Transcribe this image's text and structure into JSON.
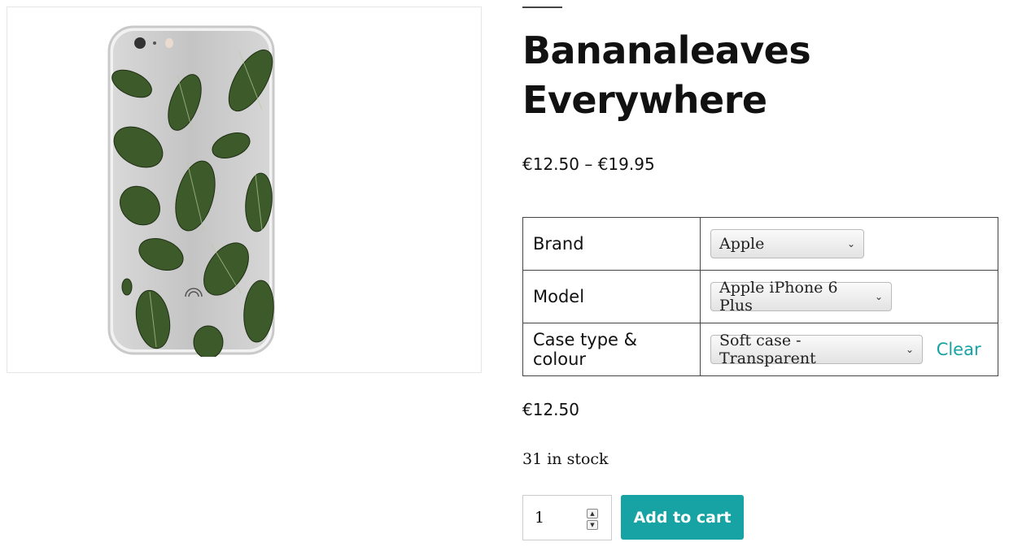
{
  "product": {
    "title": "Bananaleaves Everywhere",
    "price_range": "€12.50 – €19.95",
    "selected_price": "€12.50",
    "stock": "31 in stock",
    "image_icon": "phone-case-image"
  },
  "variations": [
    {
      "label": "Brand",
      "value": "Apple"
    },
    {
      "label": "Model",
      "value": "Apple iPhone 6 Plus"
    },
    {
      "label": "Case type & colour",
      "value": "Soft case - Transparent"
    }
  ],
  "clear_label": "Clear",
  "quantity": "1",
  "add_to_cart_label": "Add to cart",
  "colors": {
    "accent": "#17a2a4",
    "leaf": "#3d5a2a"
  }
}
